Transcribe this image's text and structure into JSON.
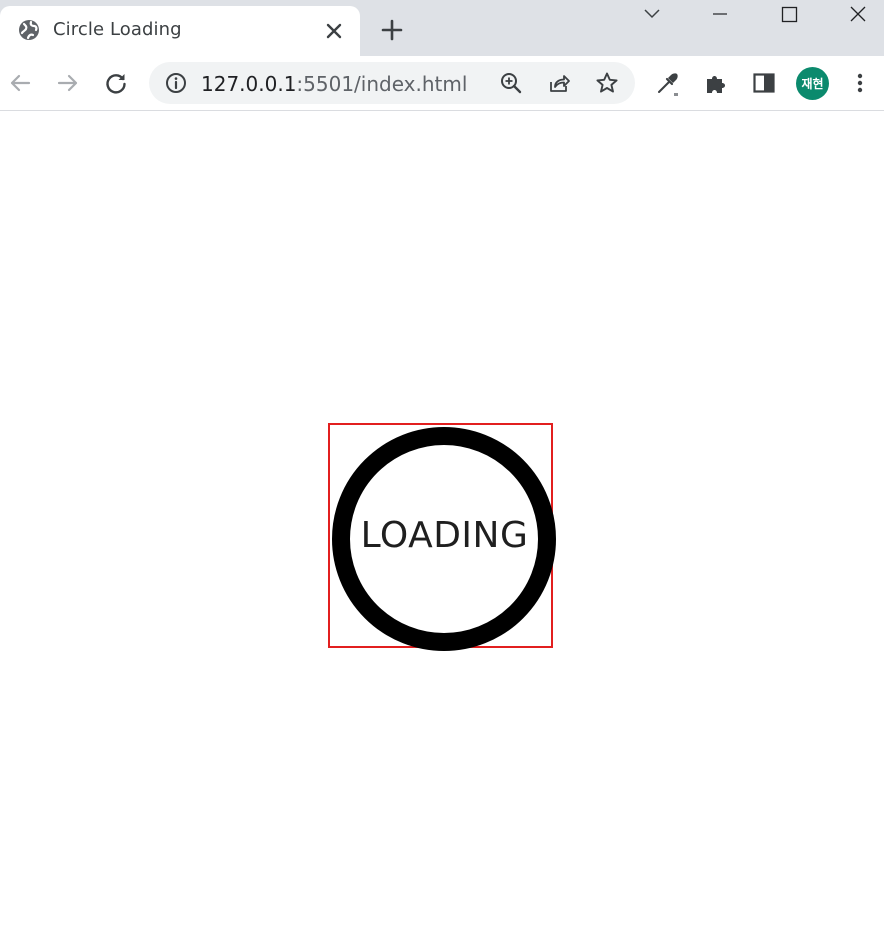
{
  "tab": {
    "title": "Circle Loading"
  },
  "omnibox": {
    "url_host": "127.0.0.1",
    "url_rest": ":5501/index.html"
  },
  "profile": {
    "avatar_text": "재현",
    "avatar_color": "#0b8a6d"
  },
  "page": {
    "loading_text": "LOADING",
    "box_border_color": "#e21f1f",
    "ring_color": "#000000"
  },
  "icons": {
    "favicon": "globe-icon",
    "tab_close": "close-icon",
    "new_tab": "plus-icon",
    "back": "arrow-left-icon",
    "forward": "arrow-right-icon",
    "reload": "reload-icon",
    "site_info": "info-icon",
    "zoom": "zoom-in-icon",
    "share": "share-icon",
    "bookmark": "star-icon",
    "eyedropper": "eyedropper-icon",
    "extensions": "puzzle-icon",
    "side_panel": "side-panel-icon",
    "menu": "kebab-menu-icon"
  }
}
